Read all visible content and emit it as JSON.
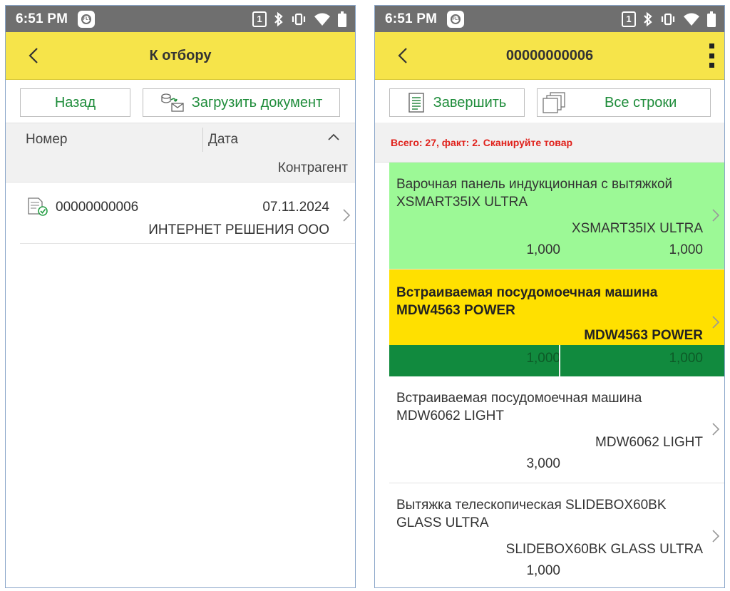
{
  "left": {
    "status": {
      "time": "6:51 PM",
      "sim": "1"
    },
    "appbar": {
      "title": "К отбору"
    },
    "toolbar": {
      "back_label": "Назад",
      "load_label": "Загрузить документ"
    },
    "columns": {
      "number": "Номер",
      "date": "Дата",
      "counterparty": "Контрагент"
    },
    "document": {
      "number": "00000000006",
      "date": "07.11.2024",
      "counterparty": "ИНТЕРНЕТ РЕШЕНИЯ ООО"
    }
  },
  "right": {
    "status": {
      "time": "6:51 PM",
      "sim": "1"
    },
    "appbar": {
      "title": "00000000006"
    },
    "toolbar": {
      "finish_label": "Завершить",
      "all_rows_label": "Все строки"
    },
    "summary": "Всего: 27, факт: 2. Сканируйте товар",
    "items": [
      {
        "name": "Варочная панель индукционная с вытяжкой XSMART35IX ULTRA",
        "code": "XSMART35IX ULTRA",
        "qty_plan": "1,000",
        "qty_fact": "1,000",
        "color": "#9cf996"
      },
      {
        "name": "Встраиваемая посудомоечная машина MDW4563 POWER",
        "code": "MDW4563 POWER",
        "qty_plan": "1,000",
        "qty_fact": "1,000",
        "color": "#ffe000",
        "active": true
      },
      {
        "name": "Встраиваемая посудомоечная машина MDW6062 LIGHT",
        "code": "MDW6062 LIGHT",
        "qty_plan": "3,000"
      },
      {
        "name": "Вытяжка телескопическая SLIDEBOX60BK GLASS ULTRA",
        "code": "SLIDEBOX60BK GLASS ULTRA",
        "qty_plan": "1,000"
      }
    ]
  },
  "colors": {
    "appbar": "#f6e44a",
    "statusbar": "#6f6f6f",
    "accent_text": "#1e8c3a",
    "done_row": "#9cf996",
    "active_row": "#ffe000",
    "active_qty_bar": "#118a3e",
    "summary_text": "#e0211b"
  },
  "icons": [
    "back-arrow-icon",
    "app-badge-icon",
    "sim-icon",
    "bluetooth-icon",
    "vibrate-icon",
    "wifi-icon",
    "battery-icon",
    "load-document-icon",
    "document-check-icon",
    "chevron-right-icon",
    "more-vert-icon",
    "finish-document-icon",
    "all-rows-icon",
    "sort-up-icon"
  ]
}
